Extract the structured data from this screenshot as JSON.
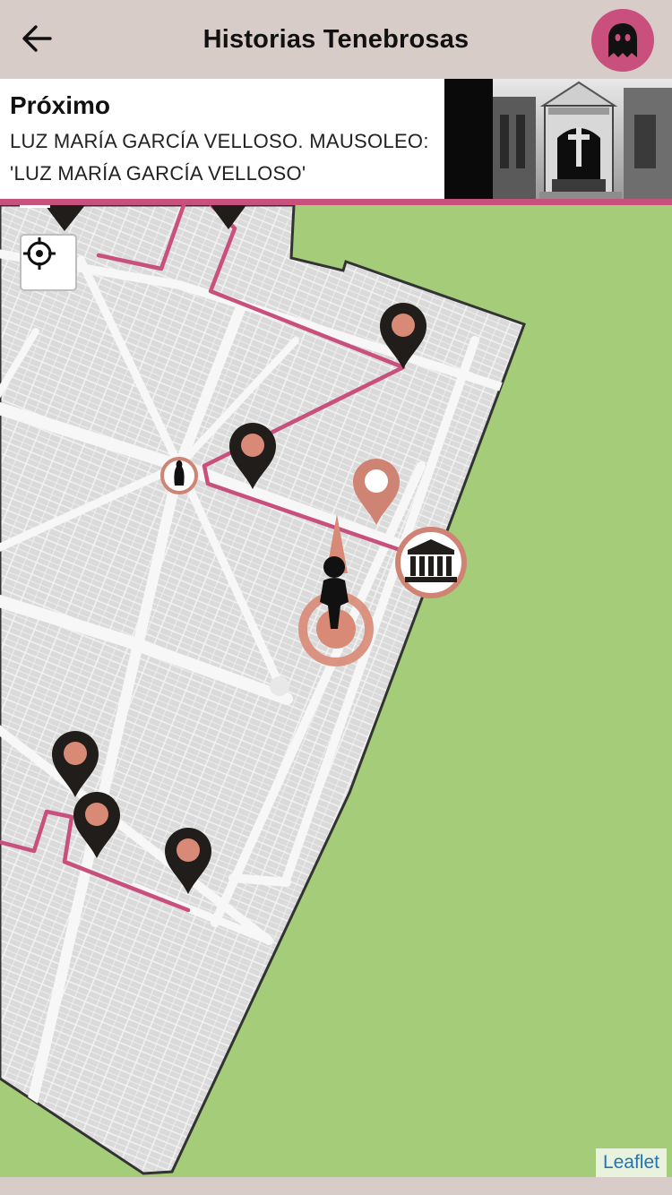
{
  "app": {
    "title": "Historias Tenebrosas",
    "accent_color": "#c94f7c"
  },
  "header": {
    "back_icon": "arrow-left-icon",
    "menu_icon": "ghost-icon"
  },
  "next_stop": {
    "label": "Próximo",
    "description": "LUZ MARÍA GARCÍA VELLOSO. MAUSOLEO: 'LUZ MARÍA GARCÍA VELLOSO'",
    "image_icon": "mausoleum-photo"
  },
  "map": {
    "locate_icon": "crosshair-icon",
    "attribution": "Leaflet",
    "route_color": "#c94f7c",
    "visited_marker_color": "#201d1a",
    "marker_dot_color": "#d98a76",
    "next_marker_color": "#cf8473",
    "park_color": "#a5cc78",
    "block_color": "#d9d9d9"
  }
}
